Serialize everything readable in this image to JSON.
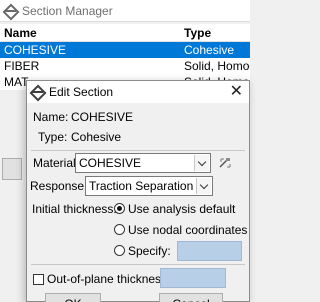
{
  "background_window": {
    "title": "Section Manager",
    "columns": [
      "Name",
      "Type"
    ],
    "rows": [
      {
        "name": "COHESIVE",
        "type": "Cohesive",
        "selected": true
      },
      {
        "name": "FIBER",
        "type": "Solid, Homoge"
      },
      {
        "name": "MAT",
        "type": "Solid, Homoge"
      }
    ]
  },
  "dialog": {
    "title": "Edit Section",
    "name_label": "Name:",
    "name_value": "COHESIVE",
    "type_label": "Type:",
    "type_value": "Cohesive",
    "material_label": "Material:",
    "material_value": "COHESIVE",
    "response_label": "Response:",
    "response_value": "Traction Separation",
    "initial_thickness_label": "Initial thickness:",
    "options": [
      {
        "label": "Use analysis default",
        "selected": true
      },
      {
        "label": "Use nodal coordinates",
        "selected": false
      },
      {
        "label": "Specify:",
        "selected": false
      }
    ],
    "out_of_plane_label": "Out-of-plane thickness:",
    "ok_label": "OK",
    "cancel_label": "Cancel"
  },
  "colors": {
    "selection": "#0078d7",
    "field_disabled": "#b8cfe8"
  }
}
